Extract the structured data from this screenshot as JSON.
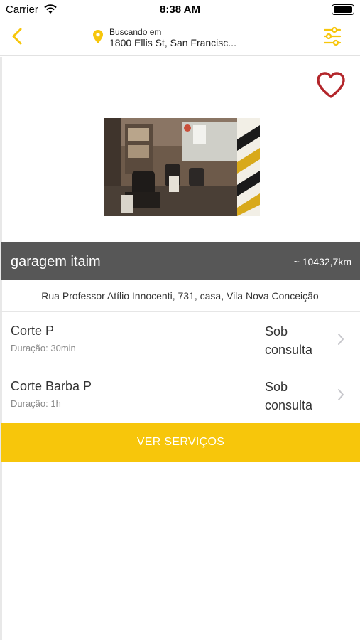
{
  "status_bar": {
    "carrier": "Carrier",
    "time": "8:38 AM"
  },
  "header": {
    "location_label": "Buscando em",
    "location_address": "1800 Ellis St, San Francisc..."
  },
  "shop": {
    "name": "garagem itaim",
    "distance": "~ 10432,7km",
    "address": "Rua Professor Atílio Innocenti, 731, casa, Vila Nova Conceição"
  },
  "services": [
    {
      "title": "Corte P",
      "duration": "Duração: 30min",
      "price_line1": "Sob",
      "price_line2": "consulta"
    },
    {
      "title": "Corte Barba P",
      "duration": "Duração: 1h",
      "price_line1": "Sob",
      "price_line2": "consulta"
    }
  ],
  "cta": {
    "label": "VER SERVIÇOS"
  },
  "colors": {
    "accent": "#f7c60b",
    "heart": "#b3262b",
    "name_bar": "#575757"
  },
  "icons": [
    "wifi-icon",
    "battery-icon",
    "back-chevron-icon",
    "location-pin-icon",
    "filter-sliders-icon",
    "favorite-heart-icon",
    "chevron-right-icon"
  ]
}
